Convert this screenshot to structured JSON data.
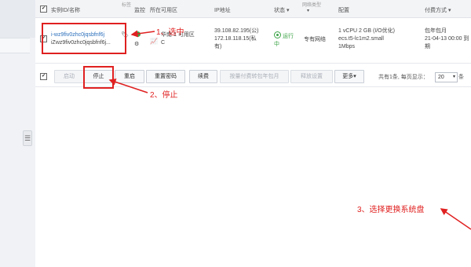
{
  "table": {
    "columns": {
      "instance": "实例ID/名称",
      "tags": "标签",
      "monitor": "监控",
      "zone": "所在可用区",
      "ip": "IP地址",
      "status": "状态",
      "status_sort_icon": "chevron-down-icon",
      "network": "网络类型",
      "config": "配置",
      "billing": "付费方式"
    },
    "row": {
      "instance_id": "i-wz9fiv0zhc0jqsbfnf6j",
      "instance_name": "iZwz9fiv0zhc0jqsbfnf6j...",
      "zone_line1": "华南 1 可用区",
      "zone_line2": "C",
      "ip_public": "39.108.82.195(公)",
      "ip_private_line1": "172.18.118.15(私",
      "ip_private_line2": "有)",
      "status_line1": "运行",
      "status_line2": "中",
      "network": "专有网络",
      "config_line1": "1 vCPU 2 GB (I/O优化)",
      "config_line2": "ecs.t5-lc1m2.small",
      "config_line3": "1Mbps",
      "billing_line1": "包年包月",
      "billing_line2": "21-04-13 00:00 到",
      "billing_line3": "期"
    }
  },
  "toolbar": {
    "start": "启动",
    "stop": "停止",
    "restart": "重启",
    "reset_password": "重置密码",
    "renew": "续费",
    "convert_billing": "按量付费转包年包月",
    "release": "释放设置",
    "more": "更多",
    "pagination_text": "共有1条, 每页显示：",
    "page_size": "20",
    "page_unit": "条"
  },
  "annotations": {
    "step1": "1、选中",
    "step2": "2、停止",
    "step3": "3、选择更换系统盘"
  },
  "colors": {
    "annotation": "#e02020",
    "link": "#2a6ebb",
    "running": "#3aa345"
  }
}
